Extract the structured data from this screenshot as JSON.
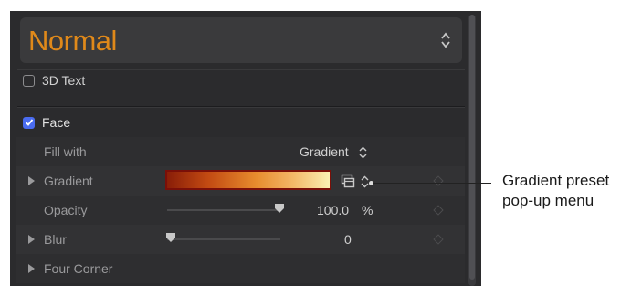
{
  "style_popup": {
    "label": "Normal"
  },
  "text_3d": {
    "label": "3D Text",
    "checked": false
  },
  "face": {
    "label": "Face",
    "checked": true
  },
  "rows": {
    "fill_with": {
      "label": "Fill with",
      "value": "Gradient"
    },
    "gradient": {
      "label": "Gradient"
    },
    "opacity": {
      "label": "Opacity",
      "value": "100.0",
      "unit": "%",
      "fraction": 1.0
    },
    "blur": {
      "label": "Blur",
      "value": "0",
      "fraction": 0.0
    },
    "four_corner": {
      "label": "Four Corner"
    }
  },
  "callout": {
    "text": "Gradient preset\npop-up menu"
  },
  "colors": {
    "accent_orange": "#e0891a",
    "checkbox_blue": "#4a6cf0",
    "panel_bg": "#2b2b2d"
  },
  "icons": [
    "chevron-updown-icon",
    "disclosure-triangle-icon",
    "keyframe-diamond-icon",
    "gradient-preset-icon",
    "checkmark-icon"
  ]
}
